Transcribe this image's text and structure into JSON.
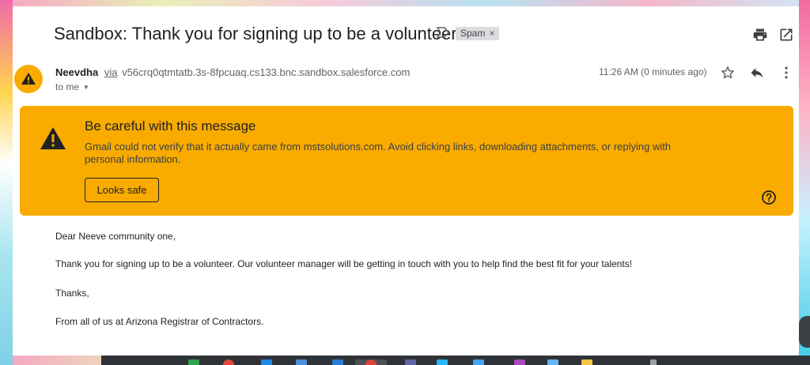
{
  "email": {
    "subject": "Sandbox: Thank you for signing up to be a volunteer",
    "label": "Spam",
    "label_close": "×",
    "sender_name": "Neevdha",
    "via": "via",
    "sender_address": "v56crq0qtmtatb.3s-8fpcuaq.cs133.bnc.sandbox.salesforce.com",
    "recipient": "to me",
    "time": "11:26 AM (0 minutes ago)"
  },
  "warning": {
    "title": "Be careful with this message",
    "text": "Gmail could not verify that it actually came from mstsolutions.com. Avoid clicking links, downloading attachments, or replying with personal information.",
    "button": "Looks safe"
  },
  "body": {
    "greeting": "Dear Neeve community one,",
    "paragraph": "Thank you for signing up to be a volunteer.  Our volunteer manager will be getting in touch with you to help find the best fit for your talents!",
    "closing": "Thanks,",
    "signature": "From all of us at Arizona Registrar of Contractors."
  },
  "icons": {
    "avatar": "warning-icon",
    "important": "label-important-icon",
    "print": "print-icon",
    "open": "open-in-new-window-icon",
    "star": "star-icon",
    "reply": "reply-icon",
    "more": "more-vert-icon",
    "help": "help-icon"
  },
  "colors": {
    "warning_bg": "#f9ab00",
    "text": "#202124",
    "muted": "#5f6368",
    "spam_badge": "#dadce0"
  }
}
